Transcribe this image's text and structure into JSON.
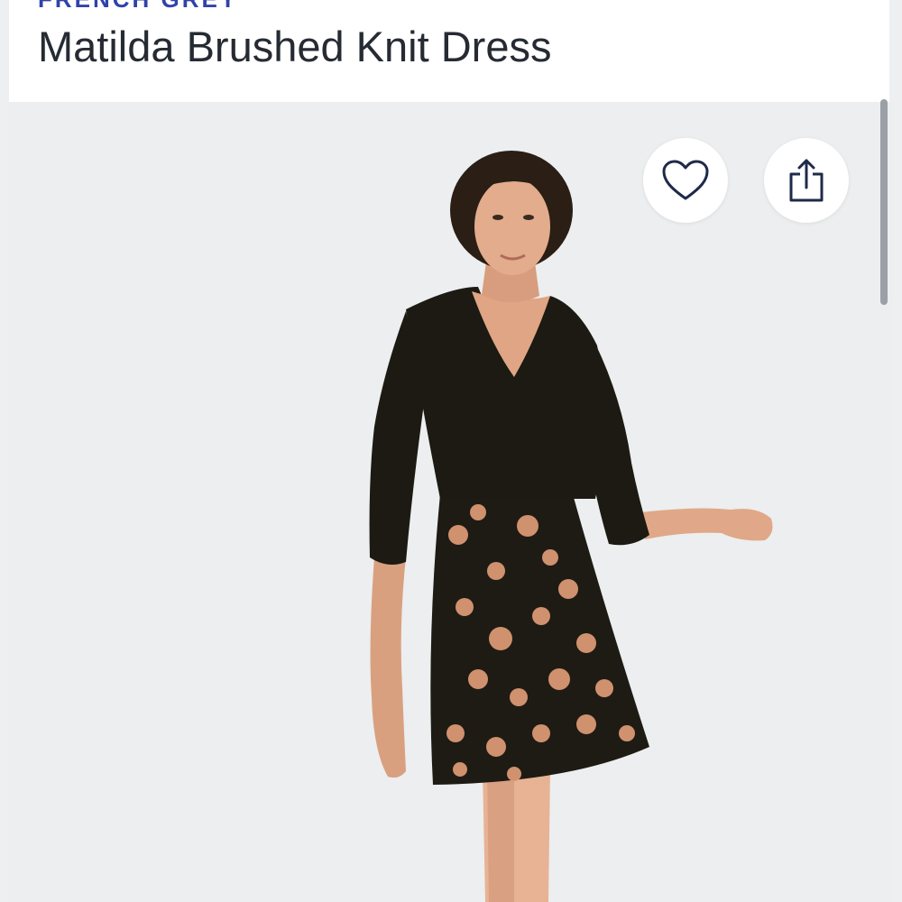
{
  "product": {
    "brand": "FRENCH GREY",
    "title": "Matilda Brushed Knit Dress"
  },
  "actions": {
    "favorite_icon": "heart-outline-icon",
    "share_icon": "share-upload-icon"
  },
  "colors": {
    "brand_accent": "#2f43a8",
    "title_text": "#262b33",
    "icon_stroke": "#1f2a4a",
    "photo_background": "#eceeef",
    "dress_bodice": "#1c1a12",
    "dress_print": "#d99873"
  }
}
